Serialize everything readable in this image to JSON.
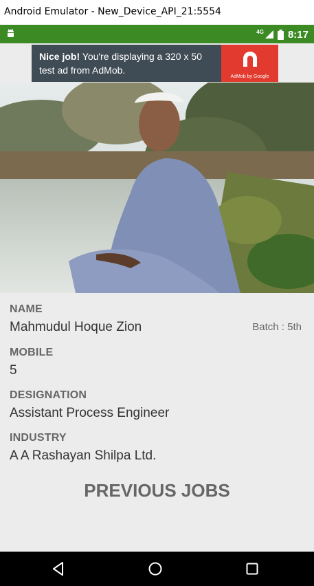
{
  "window": {
    "title": "Android Emulator - New_Device_API_21:5554"
  },
  "status_bar": {
    "network": "4G",
    "time": "8:17"
  },
  "ad": {
    "headline": "Nice job!",
    "body": " You're displaying a 320 x 50 test ad from AdMob.",
    "brand": "AdMob by Google"
  },
  "profile": {
    "name_label": "NAME",
    "name": "Mahmudul Hoque Zion",
    "batch": "Batch : 5th",
    "mobile_label": "MOBILE",
    "mobile": "5",
    "designation_label": "DESIGNATION",
    "designation": "Assistant Process Engineer",
    "industry_label": "INDUSTRY",
    "industry": "A A Rashayan Shilpa Ltd.",
    "previous_jobs_heading": "PREVIOUS JOBS"
  },
  "colors": {
    "status_bar": "#3c8a24",
    "ad_background": "#3f4b55",
    "ad_logo": "#e23a2e",
    "page_background": "#ececec"
  },
  "icons": [
    "android-icon",
    "signal-icon",
    "battery-icon",
    "admob-logo-icon",
    "back-icon",
    "home-icon",
    "recents-icon"
  ]
}
